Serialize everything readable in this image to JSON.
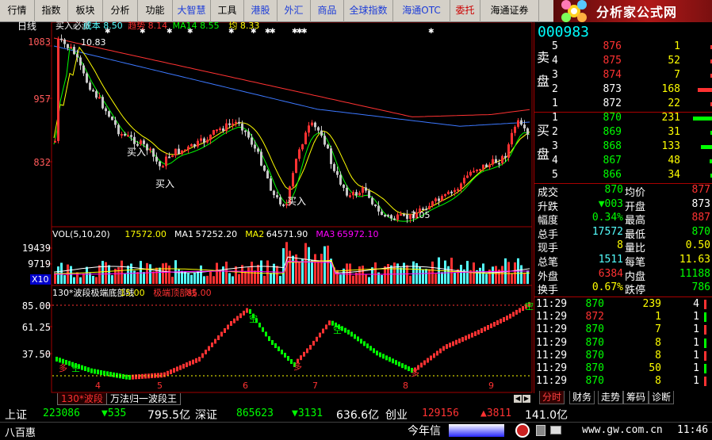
{
  "menu": {
    "items": [
      {
        "label": "行情",
        "style": "normal"
      },
      {
        "label": "指数",
        "style": "normal"
      },
      {
        "label": "板块",
        "style": "normal"
      },
      {
        "label": "分析",
        "style": "normal"
      },
      {
        "label": "功能",
        "style": "normal"
      },
      {
        "label": "大智慧",
        "style": "hot"
      },
      {
        "label": "工具",
        "style": "normal"
      },
      {
        "label": "港股",
        "style": "hot"
      },
      {
        "label": "外汇",
        "style": "hot"
      },
      {
        "label": "商品",
        "style": "hot"
      },
      {
        "label": "全球指数",
        "style": "hot"
      },
      {
        "label": "海通OTC",
        "style": "hot"
      },
      {
        "label": "委托",
        "style": "red"
      },
      {
        "label": "海通证券",
        "style": "normal"
      }
    ]
  },
  "logo": {
    "text": "分析家公式网",
    "url": "www.88gs.com"
  },
  "colors": {
    "up": "#ff3232",
    "down": "#54ffff",
    "flat": "#ffffff",
    "grid": "#a00000",
    "green": "#00ff00",
    "yellow": "#ffff00",
    "magenta": "#ff00ff"
  },
  "price_chart": {
    "period": "日线",
    "legend": [
      {
        "text": "买入必涨",
        "color": "#ffffff"
      },
      {
        "text": "成本 8.50",
        "color": "#54ffff"
      },
      {
        "text": "趋势 8.14",
        "color": "#ff3232"
      },
      {
        "text": "MA14 8.55",
        "color": "#00ff00"
      },
      {
        "text": "均 8.33",
        "color": "#ffff00"
      }
    ],
    "y_ticks": [
      "1083",
      "957",
      "832"
    ],
    "high_label": "10.83",
    "low_label": "7.05",
    "buy_markers": [
      {
        "text": "买入",
        "x": 160,
        "y": 158
      },
      {
        "text": "买入",
        "x": 196,
        "y": 198
      },
      {
        "text": "买入",
        "x": 362,
        "y": 220
      }
    ]
  },
  "volume_chart": {
    "legend": [
      {
        "text": "VOL(5,10,20)",
        "color": "#ffffff"
      },
      {
        "text": "17572.00",
        "color": "#ffff00"
      },
      {
        "text": "MA1",
        "color": "#ffffff"
      },
      {
        "text": "57252.20",
        "color": "#ffffff"
      },
      {
        "text": "MA2",
        "color": "#ffff00"
      },
      {
        "text": "64571.90",
        "color": "#ffffff"
      },
      {
        "text": "MA3",
        "color": "#ff00ff"
      },
      {
        "text": "65972.10",
        "color": "#ff00ff"
      }
    ],
    "y_ticks": [
      "19439",
      "9719"
    ],
    "unit": "X10"
  },
  "indicator_chart": {
    "legend": [
      {
        "text": "130*波段极端底部线",
        "color": "#ffffff"
      },
      {
        "text": "15.00",
        "color": "#ffff00"
      },
      {
        "text": "极端顶部线",
        "color": "#ff3232"
      },
      {
        "text": "85.00",
        "color": "#ff3232"
      }
    ],
    "y_ticks": [
      "85.00",
      "61.25",
      "37.50"
    ],
    "x_ticks": [
      "4",
      "5",
      "6",
      "7",
      "8",
      "9"
    ],
    "signals": [
      "多",
      "空",
      "空",
      "多",
      "空",
      "多",
      "空"
    ]
  },
  "bottom_tabs": [
    "130*波段",
    "万法归一波段王"
  ],
  "quote": {
    "code": "000983",
    "sell_label": "卖盘",
    "buy_label": "买盘",
    "sell": [
      {
        "level": "5",
        "price": "876",
        "vol": "1",
        "bar": 0.02
      },
      {
        "level": "4",
        "price": "875",
        "vol": "52",
        "bar": 0.04
      },
      {
        "level": "3",
        "price": "874",
        "vol": "7",
        "bar": 0.02
      },
      {
        "level": "2",
        "price": "873",
        "vol": "168",
        "bar": 0.45
      },
      {
        "level": "1",
        "price": "872",
        "vol": "22",
        "bar": 0.03
      }
    ],
    "buy": [
      {
        "level": "1",
        "price": "870",
        "vol": "231",
        "bar": 0.6
      },
      {
        "level": "2",
        "price": "869",
        "vol": "31",
        "bar": 0.08
      },
      {
        "level": "3",
        "price": "868",
        "vol": "133",
        "bar": 0.35
      },
      {
        "level": "4",
        "price": "867",
        "vol": "48",
        "bar": 0.1
      },
      {
        "level": "5",
        "price": "866",
        "vol": "34",
        "bar": 0.08
      }
    ],
    "stats": [
      {
        "k1": "成交",
        "v1": "870",
        "c1": "#00ff00",
        "k2": "均价",
        "v2": "877",
        "c2": "#ff3232"
      },
      {
        "k1": "升跌",
        "v1": "▼003",
        "c1": "#00ff00",
        "k2": "开盘",
        "v2": "873",
        "c2": "#ffffff"
      },
      {
        "k1": "幅度",
        "v1": "0.34%",
        "c1": "#00ff00",
        "k2": "最高",
        "v2": "887",
        "c2": "#ff3232"
      },
      {
        "k1": "总手",
        "v1": "17572",
        "c1": "#54ffff",
        "k2": "最低",
        "v2": "870",
        "c2": "#00ff00"
      },
      {
        "k1": "现手",
        "v1": "8",
        "c1": "#ffff00",
        "k2": "量比",
        "v2": "0.50",
        "c2": "#ffff00"
      },
      {
        "k1": "总笔",
        "v1": "1511",
        "c1": "#54ffff",
        "k2": "每笔",
        "v2": "11.63",
        "c2": "#ffff00"
      },
      {
        "k1": "外盘",
        "v1": "6384",
        "c1": "#ff3232",
        "k2": "内盘",
        "v2": "11188",
        "c2": "#00ff00"
      },
      {
        "k1": "换手",
        "v1": "0.67%",
        "c1": "#ffff00",
        "k2": "跌停",
        "v2": "786",
        "c2": "#00ff00"
      }
    ],
    "ticks": [
      {
        "time": "11:29",
        "price": "870",
        "vol": "239",
        "n": "4"
      },
      {
        "time": "11:29",
        "price": "872",
        "vol": "1",
        "n": "1"
      },
      {
        "time": "11:29",
        "price": "870",
        "vol": "7",
        "n": "1"
      },
      {
        "time": "11:29",
        "price": "870",
        "vol": "8",
        "n": "1"
      },
      {
        "time": "11:29",
        "price": "870",
        "vol": "8",
        "n": "1"
      },
      {
        "time": "11:29",
        "price": "870",
        "vol": "50",
        "n": "1"
      },
      {
        "time": "11:29",
        "price": "870",
        "vol": "8",
        "n": "1"
      }
    ],
    "tabs": [
      "分时",
      "财务",
      "走势",
      "筹码",
      "诊断"
    ]
  },
  "index_bar": {
    "sh_label": "上证",
    "sh_value": "223086",
    "sh_change": "▼535",
    "sh_amount": "795.5亿",
    "sz_label": "深证",
    "sz_value": "865623",
    "sz_change": "▼3131",
    "sz_amount": "636.6亿",
    "cy_label": "创业",
    "cy_value": "129156",
    "cy_change": "▲3811",
    "cy_amount": "141.0亿"
  },
  "status": {
    "left": "八百惠",
    "ticker": "今年信",
    "url": "www.gw.com.cn",
    "time": "11:46"
  }
}
